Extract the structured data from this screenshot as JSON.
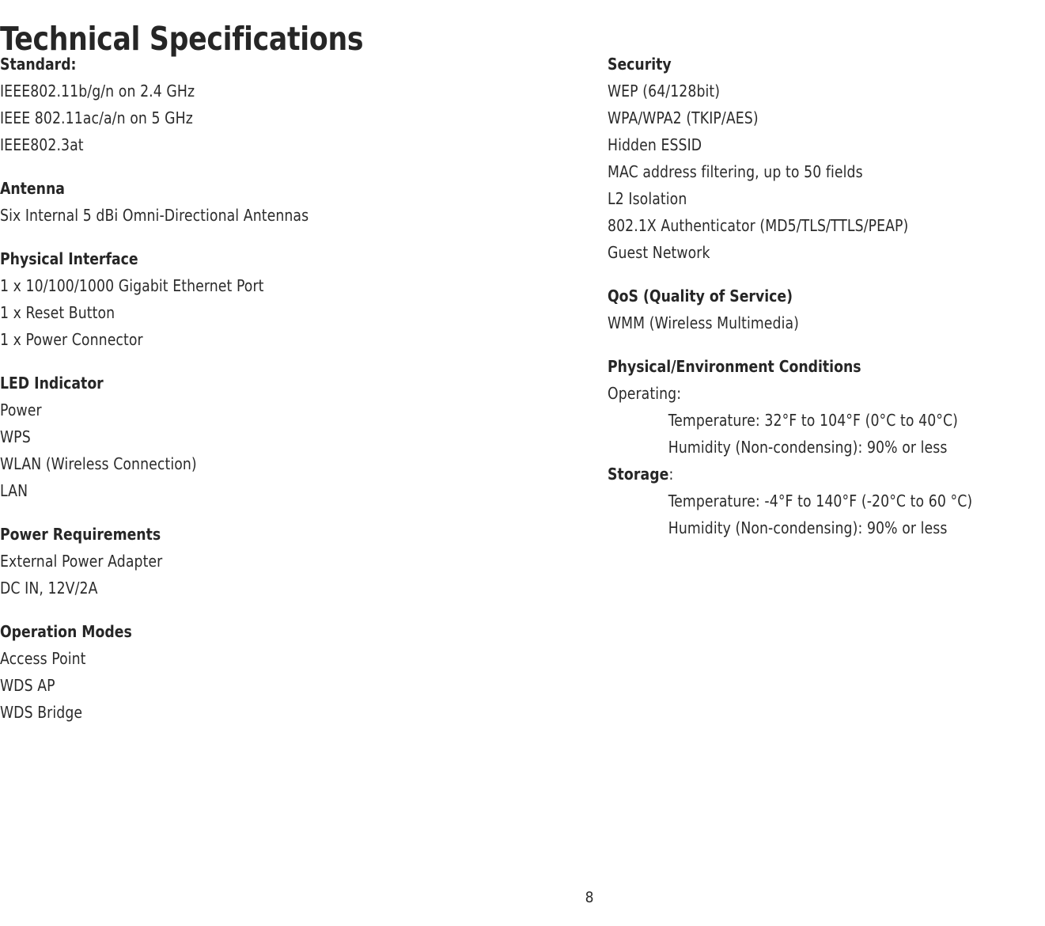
{
  "document": {
    "title": "Technical Specifications",
    "page_number": "8"
  },
  "left_column": {
    "sections": [
      {
        "heading": "Standard:",
        "lines": [
          "IEEE802.11b/g/n on 2.4 GHz",
          "IEEE 802.11ac/a/n on 5 GHz",
          "IEEE802.3at"
        ]
      },
      {
        "heading": "Antenna",
        "lines": [
          "Six Internal 5 dBi Omni-Directional Antennas"
        ]
      },
      {
        "heading": "Physical Interface",
        "lines": [
          "1 x 10/100/1000 Gigabit Ethernet Port",
          "1 x Reset Button",
          "1 x Power Connector"
        ]
      },
      {
        "heading": "LED Indicator",
        "lines": [
          "Power",
          "WPS",
          "WLAN (Wireless Connection)",
          "LAN"
        ]
      },
      {
        "heading": "Power Requirements",
        "lines": [
          "External Power Adapter",
          "DC IN, 12V/2A"
        ]
      },
      {
        "heading": "Operation Modes",
        "lines": [
          "Access Point",
          "WDS AP",
          "WDS Bridge"
        ]
      }
    ]
  },
  "right_column": {
    "sections": [
      {
        "heading": "Security",
        "lines": [
          "WEP (64/128bit)",
          "WPA/WPA2 (TKIP/AES)",
          "Hidden ESSID",
          "MAC address filtering, up to 50 fields",
          "L2 Isolation",
          "802.1X Authenticator (MD5/TLS/TTLS/PEAP)",
          "Guest Network"
        ]
      },
      {
        "heading": "QoS (Quality of Service)",
        "lines": [
          "WMM (Wireless Multimedia)"
        ]
      },
      {
        "heading": "Physical/Environment Conditions",
        "lines": [
          "Operating:"
        ],
        "operating_temperature": "Temperature: 32°F to 104°F (0°C to 40°C)",
        "operating_humidity": "Humidity (Non-condensing): 90% or less",
        "storage_label_bold": "Storage",
        "storage_label_colon": ":",
        "storage_temperature": "Temperature: -4°F to 140°F (-20°C to 60 °C)",
        "storage_humidity": "Humidity (Non-condensing): 90% or less"
      }
    ]
  }
}
